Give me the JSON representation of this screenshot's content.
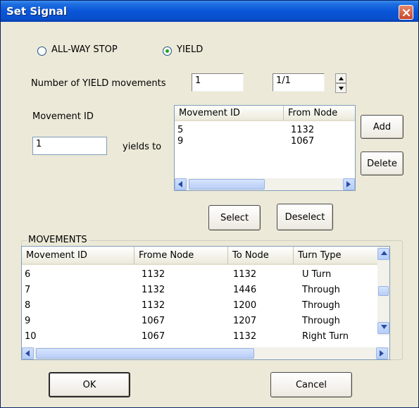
{
  "window": {
    "title": "Set Signal"
  },
  "mode": {
    "allway_label": "ALL-WAY STOP",
    "yield_label": "YIELD",
    "selected": "YIELD"
  },
  "yield_count": {
    "label": "Number of YIELD movements",
    "value": "1",
    "page_value": "1/1"
  },
  "movement": {
    "label": "Movement ID",
    "value": "1",
    "yields_to_label": "yields to"
  },
  "yield_list": {
    "columns": [
      "Movement ID",
      "From Node"
    ],
    "rows": [
      [
        "5",
        "1132"
      ],
      [
        "9",
        "1067"
      ]
    ]
  },
  "buttons": {
    "add": "Add",
    "delete": "Delete",
    "select": "Select",
    "deselect": "Deselect",
    "ok": "OK",
    "cancel": "Cancel"
  },
  "movements": {
    "group_label": "MOVEMENTS",
    "columns": [
      "Movement ID",
      "Frome Node",
      "To Node",
      "Turn Type"
    ],
    "rows": [
      [
        "6",
        "1132",
        "1132",
        "U Turn"
      ],
      [
        "7",
        "1132",
        "1446",
        "Through"
      ],
      [
        "8",
        "1132",
        "1200",
        "Through"
      ],
      [
        "9",
        "1067",
        "1207",
        "Through"
      ],
      [
        "10",
        "1067",
        "1132",
        "Right Turn"
      ]
    ]
  },
  "icons": {
    "close": "close-icon",
    "spin_up": "arrow-up-icon",
    "spin_down": "arrow-down-icon",
    "scroll_left": "arrow-left-icon",
    "scroll_right": "arrow-right-icon",
    "scroll_up": "arrow-up-icon",
    "scroll_down": "arrow-down-icon"
  }
}
